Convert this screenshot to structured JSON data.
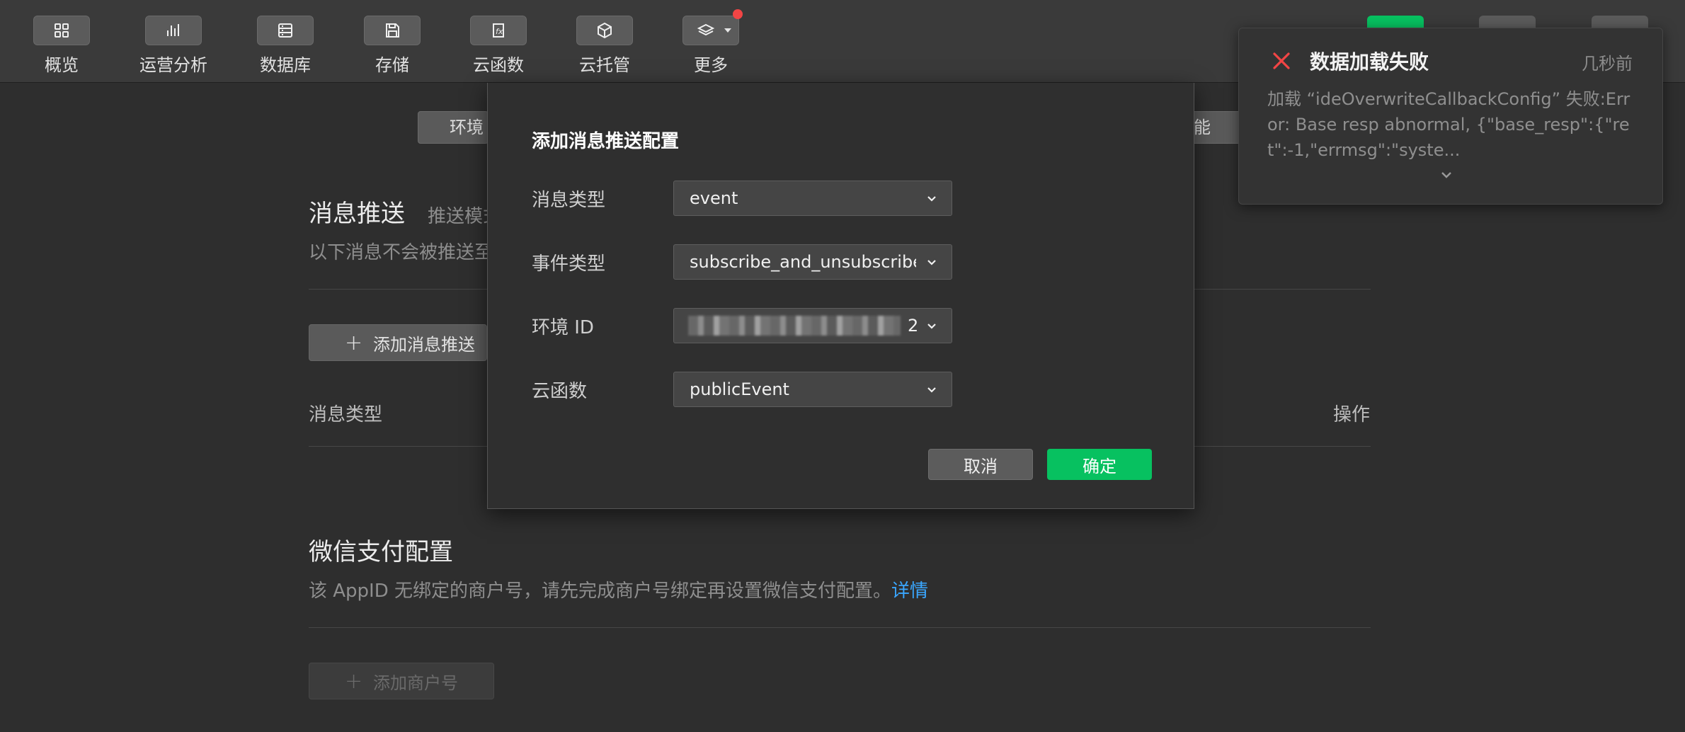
{
  "toolbar": {
    "tools": [
      {
        "label": "概览",
        "icon": "grid-icon"
      },
      {
        "label": "运营分析",
        "icon": "bar-chart-icon"
      },
      {
        "label": "数据库",
        "icon": "database-icon"
      },
      {
        "label": "存储",
        "icon": "save-icon"
      },
      {
        "label": "云函数",
        "icon": "function-icon"
      },
      {
        "label": "云托管",
        "icon": "cube-icon"
      },
      {
        "label": "更多",
        "icon": "layers-icon"
      }
    ]
  },
  "background": {
    "env_pill_left": "环境",
    "env_pill_right": "能",
    "push_section": {
      "title": "消息推送",
      "subtitle_inline": "推送模式",
      "description": "以下消息不会被推送至",
      "add_button": "添加消息推送",
      "col_type": "消息类型",
      "col_action": "操作"
    },
    "pay_section": {
      "title": "微信支付配置",
      "description": "该 AppID 无绑定的商户号，请先完成商户号绑定再设置微信支付配置。",
      "detail_link": "详情",
      "add_button": "添加商户号"
    }
  },
  "modal": {
    "title": "添加消息推送配置",
    "fields": [
      {
        "label": "消息类型",
        "value": "event"
      },
      {
        "label": "事件类型",
        "value": "subscribe_and_unsubscribe"
      },
      {
        "label": "环境 ID",
        "value": "2"
      },
      {
        "label": "云函数",
        "value": "publicEvent"
      }
    ],
    "cancel_label": "取消",
    "ok_label": "确定"
  },
  "notification": {
    "title": "数据加载失败",
    "time": "几秒前",
    "body": "加载 “ideOverwriteCallbackConfig” 失败:Error: Base resp abnormal, {\"base_resp\":{\"ret\":-1,\"errmsg\":\"syste..."
  },
  "colors": {
    "accent_green": "#07c160",
    "error_red": "#f24545",
    "link_blue": "#3aa7ff"
  }
}
